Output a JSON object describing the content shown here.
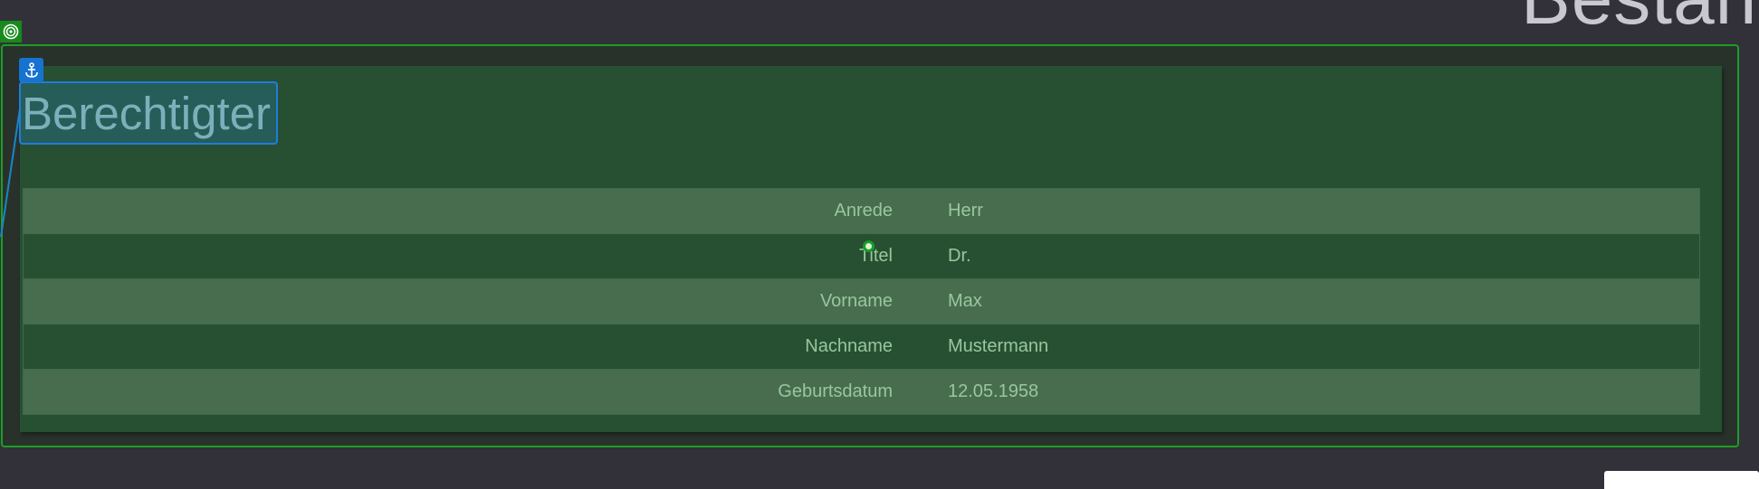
{
  "page": {
    "heading": "Bestan"
  },
  "section": {
    "title": "Berechtigter"
  },
  "fields": [
    {
      "label": "Anrede",
      "value": "Herr"
    },
    {
      "label": "Titel",
      "value": "Dr."
    },
    {
      "label": "Vorname",
      "value": "Max"
    },
    {
      "label": "Nachname",
      "value": "Mustermann"
    },
    {
      "label": "Geburtsdatum",
      "value": "12.05.1958"
    }
  ],
  "icons": {
    "target": "target-icon",
    "anchor": "anchor-icon",
    "cursor": "cursor-icon"
  },
  "colors": {
    "background": "#32313a",
    "frame_border": "#1b9f22",
    "panel": "#275032",
    "row_alt": "#476d4e",
    "text": "#98c79e",
    "selection_border": "#1d7de0",
    "anchor_badge": "#1673d1"
  }
}
